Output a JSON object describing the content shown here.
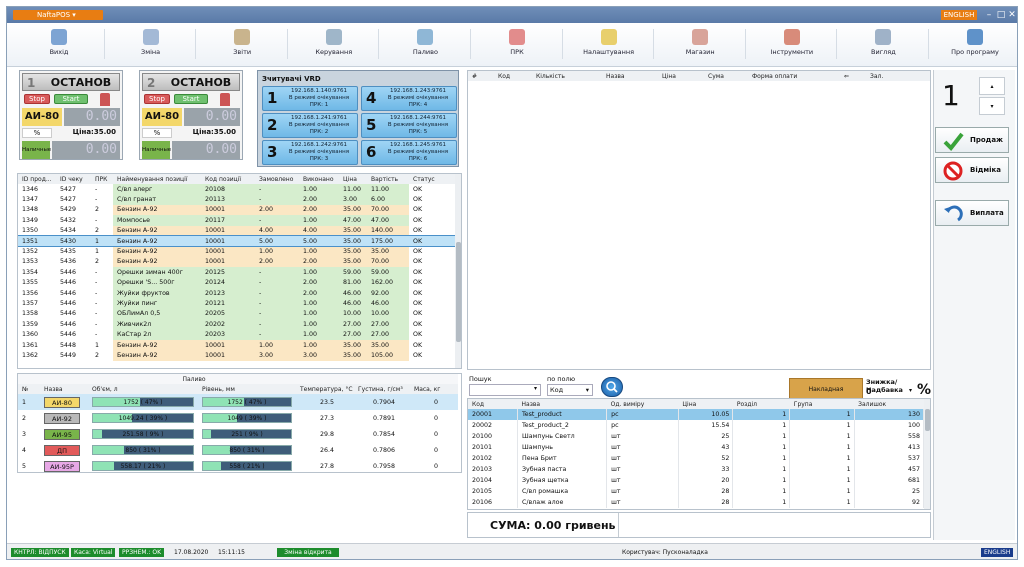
{
  "app": {
    "name": "NaftaPOS",
    "lang_button": "ENGLISH"
  },
  "toolbar": [
    {
      "label": "Вихід",
      "icon": "exit-icon",
      "color": "#7da4d3"
    },
    {
      "label": "Зміна",
      "icon": "shift-icon",
      "color": "#a3b9d6"
    },
    {
      "label": "Звіти",
      "icon": "reports-icon",
      "color": "#c9b48d"
    },
    {
      "label": "Керування",
      "icon": "bike-icon",
      "color": "#9fb6c9"
    },
    {
      "label": "Паливо",
      "icon": "fuel-icon",
      "color": "#8fb7d6"
    },
    {
      "label": "ПРК",
      "icon": "pump-icon",
      "color": "#e28c8c"
    },
    {
      "label": "Налаштування",
      "icon": "settings-folder-icon",
      "color": "#e8cf6c"
    },
    {
      "label": "Магазин",
      "icon": "shop-icon",
      "color": "#d8a49a"
    },
    {
      "label": "Інструменти",
      "icon": "tools-icon",
      "color": "#d88b7a"
    },
    {
      "label": "Вигляд",
      "icon": "view-icon",
      "color": "#9fb2c8"
    },
    {
      "label": "Про програму",
      "icon": "info-icon",
      "color": "#5f92c9"
    }
  ],
  "pumps": [
    {
      "num": "1",
      "state": "ОСТАНОВ",
      "stop": "Stop",
      "start": "Start",
      "fuel": "АИ-80",
      "lcd1": "0.00",
      "pct": "%",
      "price": "Ціна:35.00",
      "cash": "Наличные",
      "lcd2": "0.00"
    },
    {
      "num": "2",
      "state": "ОСТАНОВ",
      "stop": "Stop",
      "start": "Start",
      "fuel": "АИ-80",
      "lcd1": "0.00",
      "pct": "%",
      "price": "Ціна:35.00",
      "cash": "Наличные",
      "lcd2": "0.00"
    }
  ],
  "vrd": {
    "title": "Зчитувачі VRD",
    "items": [
      {
        "n": "1",
        "ip": "192.168.1.140:9761",
        "mode": "В режимі очікування",
        "prk": "ПРК: 1"
      },
      {
        "n": "4",
        "ip": "192.168.1.243:9761",
        "mode": "В режимі очікування",
        "prk": "ПРК: 4"
      },
      {
        "n": "2",
        "ip": "192.168.1.241:9761",
        "mode": "В режимі очікування",
        "prk": "ПРК: 2"
      },
      {
        "n": "5",
        "ip": "192.168.1.244:9761",
        "mode": "В режимі очікування",
        "prk": "ПРК: 5"
      },
      {
        "n": "3",
        "ip": "192.168.1.242:9761",
        "mode": "В режимі очікування",
        "prk": "ПРК: 3"
      },
      {
        "n": "6",
        "ip": "192.168.1.245:9761",
        "mode": "В режимі очікування",
        "prk": "ПРК: 6"
      }
    ]
  },
  "orders": {
    "headers": [
      "ID прод...",
      "ID чеку",
      "ПРК",
      "Найменування позиції",
      "Код позиції",
      "Замовлено",
      "Виконано",
      "Ціна",
      "Вартість",
      "Статус"
    ],
    "rows": [
      [
        "1346",
        "5427",
        "-",
        "С/вл алерг",
        "20108",
        "-",
        "1.00",
        "11.00",
        "11.00",
        "OK",
        "g"
      ],
      [
        "1347",
        "5427",
        "-",
        "С/вл гранат",
        "20113",
        "-",
        "2.00",
        "3.00",
        "6.00",
        "OK",
        "g"
      ],
      [
        "1348",
        "5429",
        "2",
        "Бензин А-92",
        "10001",
        "2.00",
        "2.00",
        "35.00",
        "70.00",
        "OK",
        "y"
      ],
      [
        "1349",
        "5432",
        "-",
        "Момпосье",
        "20117",
        "-",
        "1.00",
        "47.00",
        "47.00",
        "OK",
        "g"
      ],
      [
        "1350",
        "5434",
        "2",
        "Бензин А-92",
        "10001",
        "4.00",
        "4.00",
        "35.00",
        "140.00",
        "OK",
        "y"
      ],
      [
        "1351",
        "5430",
        "1",
        "Бензин А-92",
        "10001",
        "5.00",
        "5.00",
        "35.00",
        "175.00",
        "OK",
        "s"
      ],
      [
        "1352",
        "5435",
        "1",
        "Бензин А-92",
        "10001",
        "1.00",
        "1.00",
        "35.00",
        "35.00",
        "OK",
        "y"
      ],
      [
        "1353",
        "5436",
        "2",
        "Бензин А-92",
        "10001",
        "2.00",
        "2.00",
        "35.00",
        "70.00",
        "OK",
        "y"
      ],
      [
        "1354",
        "5446",
        "-",
        "Орешки зиман 400г",
        "20125",
        "-",
        "1.00",
        "59.00",
        "59.00",
        "OK",
        "g"
      ],
      [
        "1355",
        "5446",
        "-",
        "Орешки 'S... 500г",
        "20124",
        "-",
        "2.00",
        "81.00",
        "162.00",
        "OK",
        "g"
      ],
      [
        "1356",
        "5446",
        "-",
        "Жуйки фруктов",
        "20123",
        "-",
        "2.00",
        "46.00",
        "92.00",
        "OK",
        "g"
      ],
      [
        "1357",
        "5446",
        "-",
        "Жуйки пинг",
        "20121",
        "-",
        "1.00",
        "46.00",
        "46.00",
        "OK",
        "g"
      ],
      [
        "1358",
        "5446",
        "-",
        "ОБЛимАл 0,5",
        "20205",
        "-",
        "1.00",
        "10.00",
        "10.00",
        "OK",
        "g"
      ],
      [
        "1359",
        "5446",
        "-",
        "Живчик2л",
        "20202",
        "-",
        "1.00",
        "27.00",
        "27.00",
        "OK",
        "g"
      ],
      [
        "1360",
        "5446",
        "-",
        "КаСтар 2л",
        "20203",
        "-",
        "1.00",
        "27.00",
        "27.00",
        "OK",
        "g"
      ],
      [
        "1361",
        "5448",
        "1",
        "Бензин А-92",
        "10001",
        "1.00",
        "1.00",
        "35.00",
        "35.00",
        "OK",
        "y"
      ],
      [
        "1362",
        "5449",
        "2",
        "Бензин А-92",
        "10001",
        "3.00",
        "3.00",
        "35.00",
        "105.00",
        "OK",
        "y"
      ]
    ]
  },
  "tanks": {
    "group": "Паливо",
    "headers": [
      "№",
      "Назва",
      "Об'єм, л",
      "Рівень, мм",
      "Температура, °С",
      "Густина, г/см³",
      "Маса, кг"
    ],
    "rows": [
      {
        "n": "1",
        "name": "АИ-80",
        "color": "#f3d76a",
        "vol": "1752 ( 47% )",
        "vol_pct": 47,
        "lvl": "1752 ( 47% )",
        "lvl_pct": 47,
        "temp": "23.5",
        "dens": "0.7904",
        "mass": "0"
      },
      {
        "n": "2",
        "name": "АИ-92",
        "color": "#b9b9b9",
        "vol": "1049.24 ( 39% )",
        "vol_pct": 39,
        "lvl": "1049 ( 39% )",
        "lvl_pct": 39,
        "temp": "27.3",
        "dens": "0.7891",
        "mass": "0"
      },
      {
        "n": "3",
        "name": "АИ-95",
        "color": "#79b44a",
        "vol": "251.58 ( 9% )",
        "vol_pct": 9,
        "lvl": "251 ( 9% )",
        "lvl_pct": 9,
        "temp": "29.8",
        "dens": "0.7854",
        "mass": "0"
      },
      {
        "n": "4",
        "name": "ДП",
        "color": "#e25a5a",
        "vol": "850 ( 31% )",
        "vol_pct": 31,
        "lvl": "850 ( 31% )",
        "lvl_pct": 31,
        "temp": "26.4",
        "dens": "0.7806",
        "mass": "0"
      },
      {
        "n": "5",
        "name": "АИ-95Р",
        "color": "#e7a8e6",
        "vol": "558.17 ( 21% )",
        "vol_pct": 21,
        "lvl": "558 ( 21% )",
        "lvl_pct": 21,
        "temp": "27.8",
        "dens": "0.7958",
        "mass": "0"
      }
    ]
  },
  "receipt": {
    "headers": [
      "#",
      "Код",
      "Кількість",
      "Назва",
      "Ціна",
      "Сума",
      "Форма оплати",
      "⇐",
      "Зал."
    ]
  },
  "right": {
    "qty": "1",
    "sell": "Продаж",
    "cancel": "Відміка",
    "payout": "Виплата"
  },
  "search": {
    "label": "Пошук",
    "by_field": "по полю",
    "field_value": "Код",
    "invoice": "Накладная",
    "discount_label": "Знижка/Надбавка",
    "discount_value": "0",
    "percent": "%",
    "headers": [
      "Код",
      "Назва",
      "Од. виміру",
      "Ціна",
      "Розділ",
      "Група",
      "Залишок"
    ],
    "rows": [
      [
        "20001",
        "Test_product",
        "pc",
        "10.05",
        "1",
        "1",
        "130"
      ],
      [
        "20002",
        "Test_product_2",
        "pc",
        "15.54",
        "1",
        "1",
        "100"
      ],
      [
        "20100",
        "Шампунь Светл",
        "шт",
        "25",
        "1",
        "1",
        "558"
      ],
      [
        "20101",
        "Шампунь",
        "шт",
        "43",
        "1",
        "1",
        "413"
      ],
      [
        "20102",
        "Пена Брит",
        "шт",
        "52",
        "1",
        "1",
        "537"
      ],
      [
        "20103",
        "Зубная паста",
        "шт",
        "33",
        "1",
        "1",
        "457"
      ],
      [
        "20104",
        "Зубная щетка",
        "шт",
        "20",
        "1",
        "1",
        "681"
      ],
      [
        "20105",
        "С/вл ромашка",
        "шт",
        "28",
        "1",
        "1",
        "25"
      ],
      [
        "20106",
        "С/влаж алое",
        "шт",
        "28",
        "1",
        "1",
        "92"
      ]
    ]
  },
  "total": "СУМА: 0.00 гривень",
  "statusbar": {
    "ctrl": "КНТРЛ: ВІДПУСК",
    "kasa": "Каса: Virtual",
    "rrr": "РРЗНЕМ.: OK",
    "date": "17.08.2020",
    "time": "15:11:15",
    "shift": "Зміна відкрита",
    "user": "Користувач: Пусконаладка",
    "lang": "ENGLISH"
  }
}
